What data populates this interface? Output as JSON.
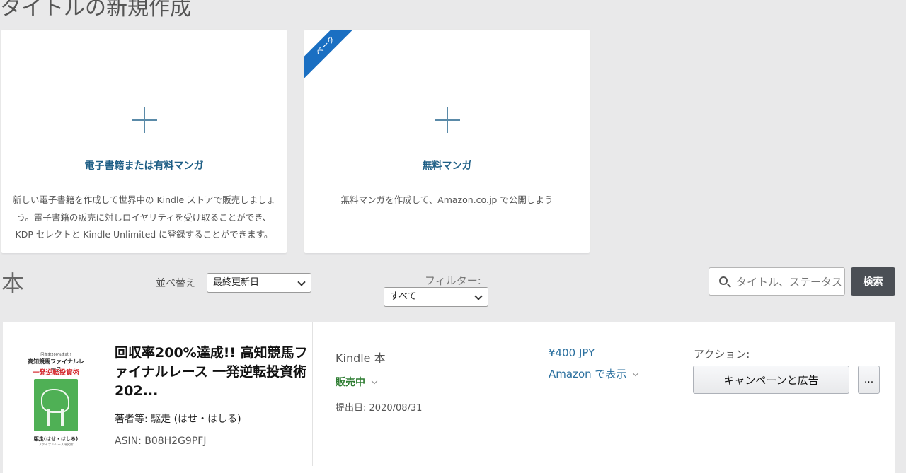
{
  "header": {
    "page_title": "タイトルの新規作成"
  },
  "create_cards": {
    "ebook": {
      "title": "電子書籍または有料マンガ",
      "description": "新しい電子書籍を作成して世界中の Kindle ストアで販売しましょう。電子書籍の販売に対しロイヤリティを受け取ることができ、KDP セレクトと Kindle Unlimited に登録することができます。"
    },
    "free_manga": {
      "badge": "ベータ",
      "title": "無料マンガ",
      "description": "無料マンガを作成して、Amazon.co.jp で公開しよう"
    }
  },
  "books_section": {
    "title": "本",
    "sort_label": "並べ替え",
    "sort_value": "最終更新日",
    "filter_label": "フィルター:",
    "filter_value": "すべて",
    "search_placeholder": "タイトル、ステータス",
    "search_button": "検索"
  },
  "book": {
    "cover": {
      "top_text": "回収率200%達成!!",
      "line1": "高知競馬ファイナルレース",
      "line2": "一発逆転投資術",
      "author": "駆走(はせ・はしる)",
      "publisher": "ファイナルレース研究所"
    },
    "title": "回収率200%達成!! 高知競馬ファイナルレース 一発逆転投資術202...",
    "author_line": "著者等: 駆走 (はせ・はしる)",
    "asin_line": "ASIN: B08H2G9PFJ",
    "format": "Kindle 本",
    "status": "販売中",
    "submitted": "提出日: 2020/08/31",
    "price": "¥400 JPY",
    "view_on": "Amazon で表示",
    "actions_label": "アクション:",
    "campaign_button": "キャンペーンと広告",
    "more_button": "..."
  },
  "colors": {
    "background": "#e9e9ea",
    "link_blue": "#2a6f9e",
    "card_title_blue": "#1f5f86",
    "status_green": "#2e7d32",
    "beta_ribbon": "#1a6fc2",
    "search_button": "#4b4f55"
  }
}
